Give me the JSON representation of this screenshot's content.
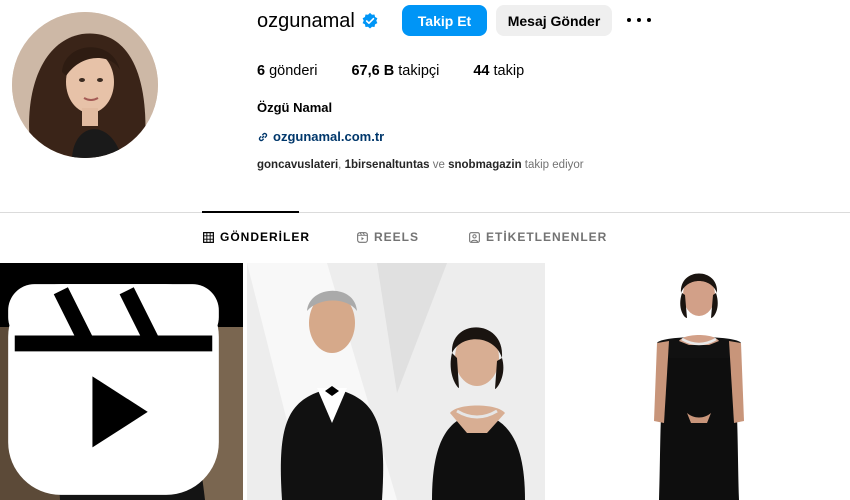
{
  "profile": {
    "username": "ozgunamal",
    "verified": true,
    "full_name": "Özgü Namal",
    "website": "ozgunamal.com.tr",
    "followed_by": {
      "users": [
        "goncavuslateri",
        "1birsenaltuntas",
        "snobmagazin"
      ],
      "sep1": ", ",
      "sep2": " ve ",
      "suffix": " takip ediyor"
    }
  },
  "actions": {
    "follow_label": "Takip Et",
    "message_label": "Mesaj Gönder"
  },
  "stats": {
    "posts_count": "6",
    "posts_label": "gönderi",
    "followers_count": "67,6 B",
    "followers_label": "takipçi",
    "following_count": "44",
    "following_label": "takip"
  },
  "tabs": [
    {
      "label": "GÖNDERİLER",
      "icon": "grid-icon",
      "active": true
    },
    {
      "label": "REELS",
      "icon": "reels-icon",
      "active": false
    },
    {
      "label": "ETİKETLENENLER",
      "icon": "tag-icon",
      "active": false
    }
  ],
  "colors": {
    "accent": "#0095f6",
    "link": "#00376b",
    "secondary_text": "#737373",
    "button_secondary": "#efefef"
  },
  "posts": [
    {
      "type": "reel",
      "icon": "reels-icon"
    },
    {
      "type": "photo"
    },
    {
      "type": "photo"
    }
  ]
}
